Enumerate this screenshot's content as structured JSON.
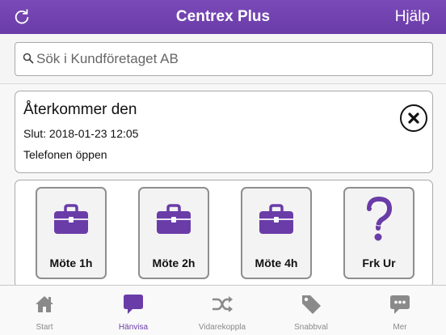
{
  "colors": {
    "brand": "#6a3ca8",
    "tab_inactive": "#8a8a8a",
    "border": "#a9a9a9"
  },
  "navbar": {
    "title": "Centrex Plus",
    "help_label": "Hjälp",
    "refresh_icon": "refresh-icon"
  },
  "search": {
    "placeholder": "Sök i Kundföretaget AB",
    "value": "",
    "icon": "search-icon"
  },
  "status": {
    "title": "Återkommer den",
    "end_text": "Slut: 2018-01-23 12:05",
    "phone_text": "Telefonen öppen",
    "close_icon": "close-icon"
  },
  "shortcuts": [
    {
      "label": "Möte 1h",
      "icon": "briefcase-icon"
    },
    {
      "label": "Möte 2h",
      "icon": "briefcase-icon"
    },
    {
      "label": "Möte 4h",
      "icon": "briefcase-icon"
    },
    {
      "label": "Frk Ur",
      "icon": "question-mark-icon"
    }
  ],
  "tabs": [
    {
      "label": "Start",
      "icon": "home-icon",
      "active": false
    },
    {
      "label": "Hänvisa",
      "icon": "speech-bubble-icon",
      "active": true
    },
    {
      "label": "Vidarekoppla",
      "icon": "shuffle-icon",
      "active": false
    },
    {
      "label": "Snabbval",
      "icon": "tag-icon",
      "active": false
    },
    {
      "label": "Mer",
      "icon": "chat-more-icon",
      "active": false
    }
  ]
}
